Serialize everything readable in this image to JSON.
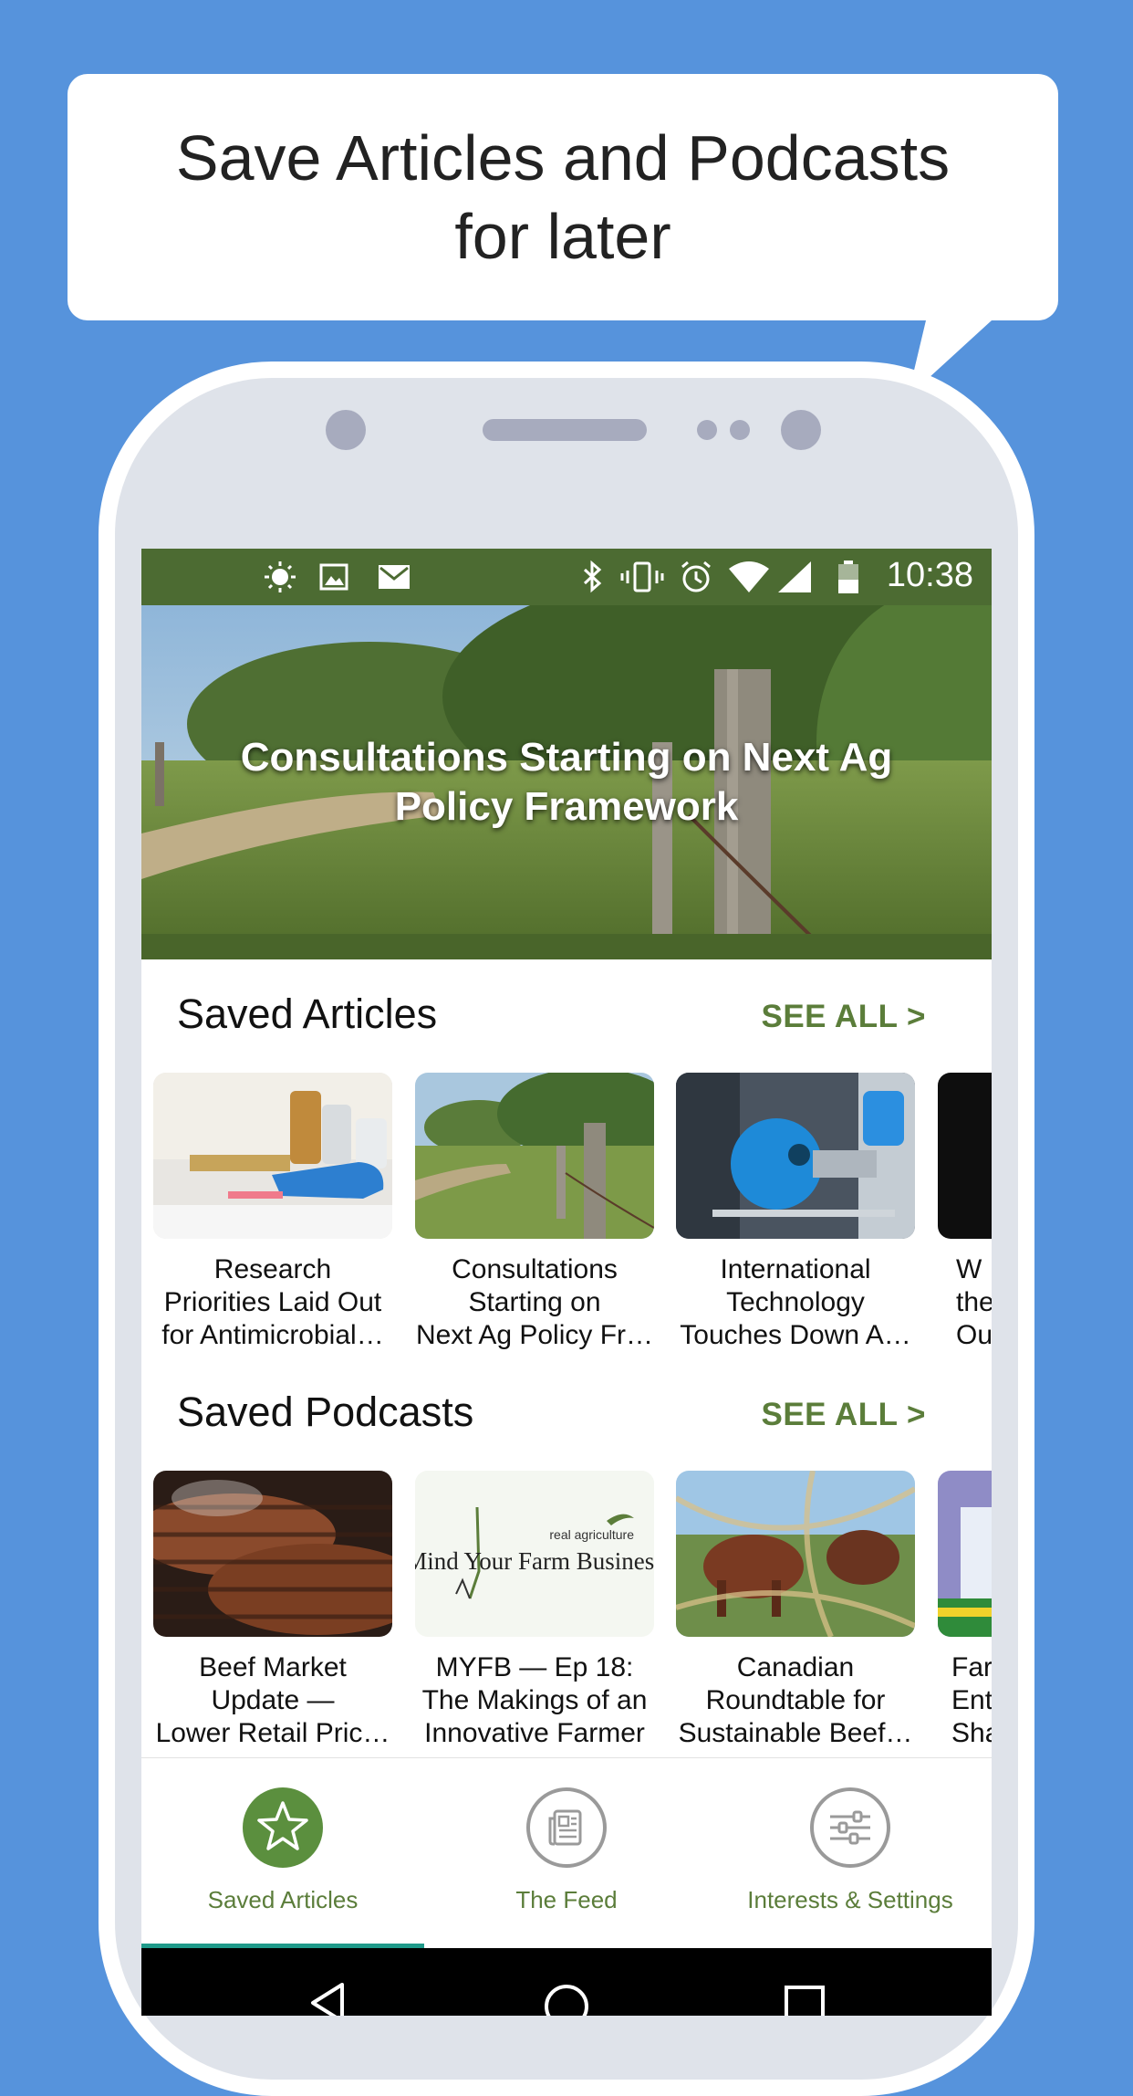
{
  "promo": {
    "line1": "Save Articles and Podcasts",
    "line2": "for later"
  },
  "statusbar": {
    "icons": [
      "brightness-icon",
      "image-icon",
      "gmail-icon",
      "bluetooth-icon",
      "vibrate-icon",
      "alarm-icon",
      "wifi-icon",
      "signal-icon",
      "battery-icon"
    ],
    "time": "10:38"
  },
  "hero": {
    "title": "Consultations Starting on Next Ag Policy Framework"
  },
  "saved_articles": {
    "title": "Saved Articles",
    "see_all": "SEE ALL >",
    "items": [
      {
        "line1": "Research",
        "line2": "Priorities Laid Out",
        "line3": "for Antimicrobial…"
      },
      {
        "line1": "Consultations",
        "line2": "Starting on",
        "line3": "Next Ag Policy Fr…"
      },
      {
        "line1": "International",
        "line2": "Technology",
        "line3": "Touches Down A…"
      },
      {
        "line1": "W",
        "line2": "the",
        "line3": "Our"
      }
    ]
  },
  "saved_podcasts": {
    "title": "Saved Podcasts",
    "see_all": "SEE ALL >",
    "podcast_logo": {
      "brand": "real agriculture",
      "name": "Mind Your Farm Business"
    },
    "items": [
      {
        "line1": "Beef Market",
        "line2": "Update —",
        "line3": "Lower Retail Pric…"
      },
      {
        "line1": "MYFB — Ep 18:",
        "line2": "The Makings of an",
        "line3": "Innovative Farmer"
      },
      {
        "line1": "Canadian",
        "line2": "Roundtable for",
        "line3": "Sustainable Beef…"
      },
      {
        "line1": "Far",
        "line2": "Ent",
        "line3": "Sha"
      }
    ]
  },
  "bottom_nav": {
    "items": [
      {
        "label": "Saved Articles",
        "icon": "star-icon",
        "active": true
      },
      {
        "label": "The Feed",
        "icon": "newspaper-icon",
        "active": false
      },
      {
        "label": "Interests & Settings",
        "icon": "sliders-icon",
        "active": false
      }
    ]
  },
  "colors": {
    "background": "#5693dc",
    "statusbar": "#4c6b32",
    "accent": "#5b7d3a",
    "indicator": "#1f9a8a"
  }
}
